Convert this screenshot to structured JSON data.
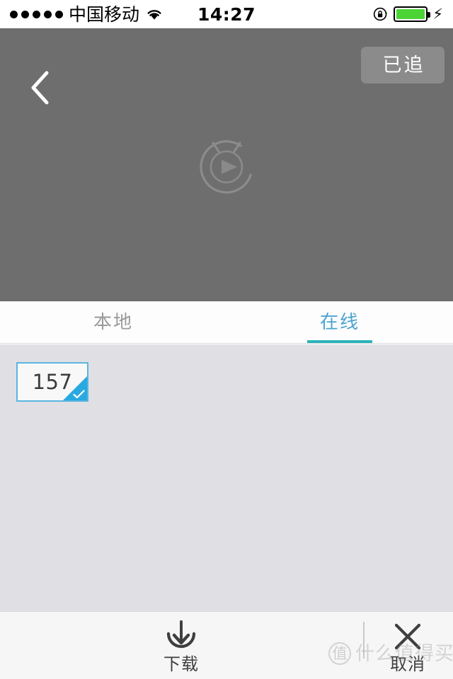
{
  "status_bar": {
    "signal_dots": 5,
    "carrier": "中国移动",
    "wifi_icon": "wifi-icon",
    "time": "14:27",
    "rotation_lock_icon": "rotation-lock-icon",
    "battery_icon": "battery-icon",
    "battery_color": "#4cd437",
    "charging_icon": "charging-bolt-icon"
  },
  "player": {
    "background_color": "#6e6e6e",
    "back_icon": "back-chevron-icon",
    "follow_button_label": "已追",
    "placeholder_icon": "play-placeholder-icon"
  },
  "tabs": {
    "items": [
      {
        "label": "本地",
        "active": false
      },
      {
        "label": "在线",
        "active": true
      }
    ],
    "active_color": "#4ba3cf",
    "inactive_color": "#9a9a9a",
    "indicator_color": "#2cb3b9"
  },
  "episode_list": {
    "background_color": "#e0e0e4",
    "items": [
      {
        "number": "157",
        "selected": true
      }
    ],
    "selected_accent": "#29a9e1",
    "check_icon": "check-icon"
  },
  "bottom_bar": {
    "actions": [
      {
        "icon": "download-icon",
        "label": "下载"
      },
      {
        "icon": "close-x-icon",
        "label": "取消"
      }
    ]
  },
  "watermark": {
    "badge": "值",
    "text": "什么值得买"
  }
}
